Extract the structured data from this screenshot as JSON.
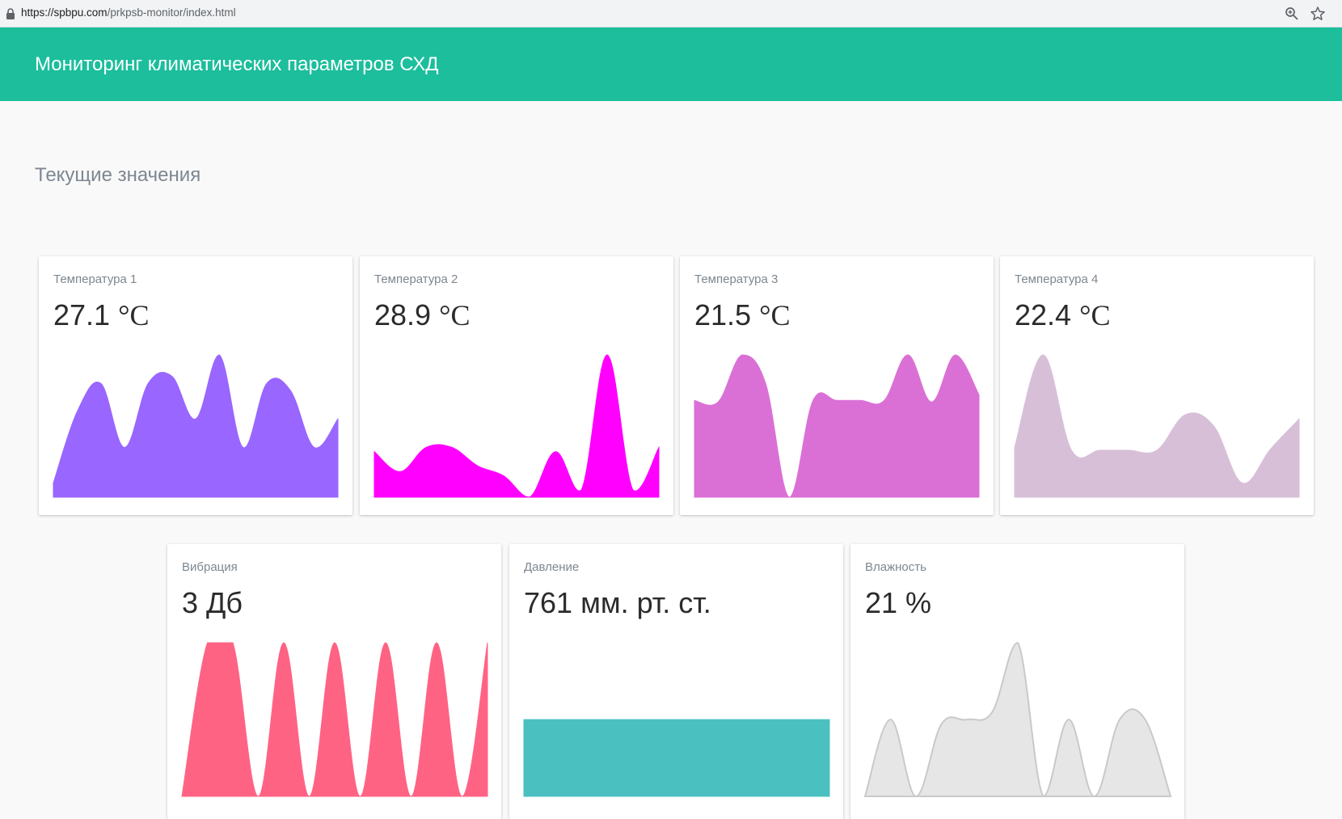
{
  "browser": {
    "url_domain": "https://spbpu.com",
    "url_path": "/prkpsb-monitor/index.html",
    "lock_icon": "lock-icon",
    "zoom_icon": "zoom-icon",
    "bookmark_icon": "star-icon"
  },
  "header": {
    "title": "Мониторинг климатических параметров СХД",
    "color": "#1cbe9c"
  },
  "section": {
    "title": "Текущие значения"
  },
  "cards": [
    {
      "label": "Температура 1",
      "value": "27.1",
      "unit": "°C",
      "color": "#9966ff",
      "series": [
        0.1,
        0.6,
        0.8,
        0.35,
        0.8,
        0.85,
        0.55,
        1.0,
        0.35,
        0.8,
        0.75,
        0.35,
        0.55
      ]
    },
    {
      "label": "Температура 2",
      "value": "28.9",
      "unit": "°C",
      "color": "#ff00ff",
      "series": [
        0.32,
        0.18,
        0.35,
        0.35,
        0.22,
        0.15,
        0.0,
        0.32,
        0.05,
        1.0,
        0.05,
        0.35
      ]
    },
    {
      "label": "Температура 3",
      "value": "21.5",
      "unit": "°C",
      "color": "#da70d6",
      "series": [
        0.68,
        0.67,
        1.0,
        0.8,
        0.0,
        0.68,
        0.68,
        0.68,
        0.68,
        1.0,
        0.67,
        1.0,
        0.72
      ]
    },
    {
      "label": "Температура 4",
      "value": "22.4",
      "unit": "°C",
      "color": "#d8bfd8",
      "series": [
        0.35,
        1.0,
        0.33,
        0.33,
        0.33,
        0.33,
        0.58,
        0.5,
        0.1,
        0.34,
        0.55
      ]
    },
    {
      "label": "Вибрация",
      "value": "3 Дб",
      "unit": "",
      "color": "#ff6384",
      "series": [
        0.0,
        1.0,
        1.0,
        0.0,
        1.0,
        0.0,
        1.0,
        0.0,
        1.0,
        0.0,
        1.0,
        0.0,
        1.0
      ]
    },
    {
      "label": "Давление",
      "value": "761 мм. рт. ст.",
      "unit": "",
      "color": "#4bc0c0",
      "series": [
        0.5,
        0.5,
        0.5,
        0.5,
        0.5,
        0.5
      ]
    },
    {
      "label": "Влажность",
      "value": "21 %",
      "unit": "",
      "color": "#e6e6e6",
      "stroke": "#c9c9c9",
      "series": [
        0.0,
        0.5,
        0.0,
        0.47,
        0.5,
        0.55,
        1.0,
        0.0,
        0.5,
        0.0,
        0.5,
        0.5,
        0.0
      ]
    }
  ]
}
